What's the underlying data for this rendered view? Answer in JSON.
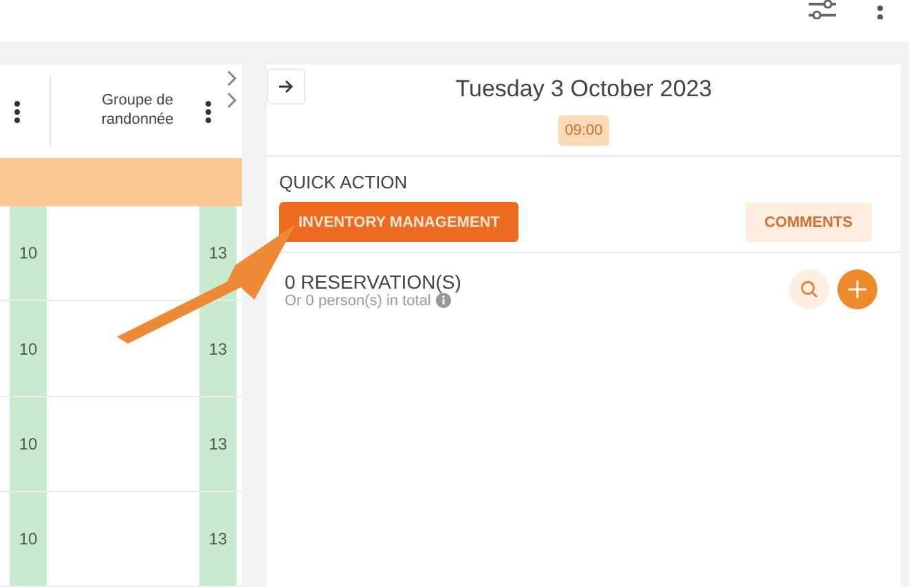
{
  "table": {
    "columns": [
      {
        "label": "Groupe de randonnée"
      }
    ],
    "rows": [
      {
        "cells": [
          "10",
          "13"
        ]
      },
      {
        "cells": [
          "10",
          "13"
        ]
      },
      {
        "cells": [
          "10",
          "13"
        ]
      },
      {
        "cells": [
          "10",
          "13"
        ]
      }
    ]
  },
  "detail": {
    "date": "Tuesday 3 October 2023",
    "time": "09:00",
    "quick_action_title": "QUICK ACTION",
    "actions": [
      {
        "label": "INVENTORY MANAGEMENT",
        "kind": "primary"
      },
      {
        "label": "COMMENTS",
        "kind": "secondary"
      }
    ],
    "reservations": {
      "title": "0 RESERVATION(S)",
      "subtitle": "Or 0 person(s) in total"
    }
  }
}
